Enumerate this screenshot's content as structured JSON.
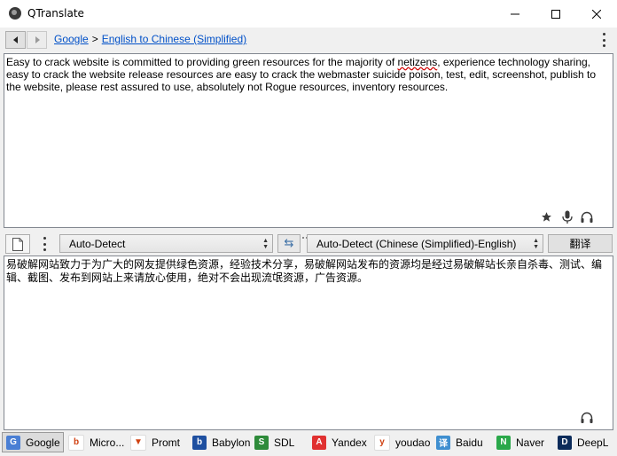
{
  "window": {
    "title": "QTranslate",
    "min_glyph": "—",
    "close_glyph": "✕"
  },
  "breadcrumb": {
    "service": "Google",
    "separator": ">",
    "direction": "English to Chinese (Simplified)"
  },
  "source": {
    "text_before": "Easy to crack website is committed to providing green resources for the majority of ",
    "misspelled_word": "netizens",
    "text_after": ", experience technology sharing, easy to crack the website release resources are easy to crack the webmaster suicide poison, test, edit, screenshot, publish to the website, please rest assured to use, absolutely not Rogue resources, inventory resources."
  },
  "toolbar": {
    "source_language": "Auto-Detect",
    "target_language": "Auto-Detect (Chinese (Simplified)-English)",
    "translate_label": "翻译",
    "swap_glyph": "⇆"
  },
  "result": {
    "text": "易破解网站致力于为广大的网友提供绿色资源，经验技术分享，易破解网站发布的资源均是经过易破解站长亲自杀毒、测试、编辑、截图、发布到网站上来请放心使用，绝对不会出现流氓资源，广告资源。"
  },
  "services": [
    {
      "label": "Google",
      "icon": "google-icon",
      "color": "#4a7fd4",
      "glyph": "G",
      "active": true
    },
    {
      "label": "Micro...",
      "icon": "bing-icon",
      "color": "#ffffff",
      "glyph": "b",
      "active": false
    },
    {
      "label": "Promt",
      "icon": "promt-icon",
      "color": "#ffffff",
      "glyph": "▼",
      "active": false
    },
    {
      "label": "Babylon",
      "icon": "babylon-icon",
      "color": "#1e4fa0",
      "glyph": "b",
      "active": false
    },
    {
      "label": "SDL",
      "icon": "sdl-icon",
      "color": "#2e8b3a",
      "glyph": "S",
      "active": false
    },
    {
      "label": "Yandex",
      "icon": "yandex-icon",
      "color": "#e03030",
      "glyph": "A",
      "active": false
    },
    {
      "label": "youdao",
      "icon": "youdao-icon",
      "color": "#ffffff",
      "glyph": "y",
      "active": false
    },
    {
      "label": "Baidu",
      "icon": "baidu-icon",
      "color": "#3f8fd0",
      "glyph": "译",
      "active": false
    },
    {
      "label": "Naver",
      "icon": "naver-icon",
      "color": "#2aa84a",
      "glyph": "N",
      "active": false
    },
    {
      "label": "DeepL",
      "icon": "deepl-icon",
      "color": "#0b2b5a",
      "glyph": "D",
      "active": false
    }
  ]
}
